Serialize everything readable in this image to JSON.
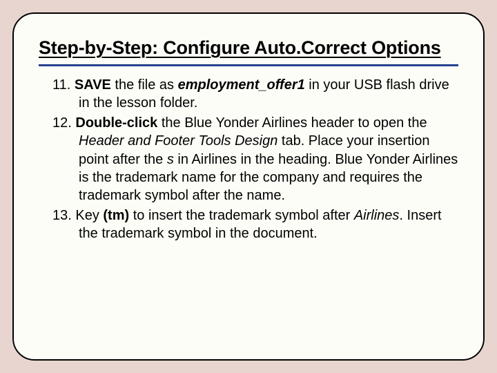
{
  "title": "Step-by-Step: Configure Auto.Correct Options",
  "steps": {
    "s11": {
      "num": "11.",
      "p1a": "SAVE",
      "p1b": " the file as ",
      "p1c": "employment_offer1",
      "p1d": " in your USB flash drive in the lesson folder."
    },
    "s12": {
      "num": "12.",
      "p2a": "Double-click",
      "p2b": " the Blue Yonder Airlines header to open the ",
      "p2c": "Header and Footer Tools Design",
      "p2d": " tab. Place your insertion point after the ",
      "p2e": "s",
      "p2f": " in Airlines in the heading. Blue Yonder Airlines is the trademark name for the company and requires the trademark symbol after the name."
    },
    "s13": {
      "num": "13.",
      "p3a": " Key ",
      "p3b": "(tm)",
      "p3c": " to insert the trademark symbol after ",
      "p3d": "Airlines",
      "p3e": ". Insert the trademark symbol in the document."
    }
  }
}
